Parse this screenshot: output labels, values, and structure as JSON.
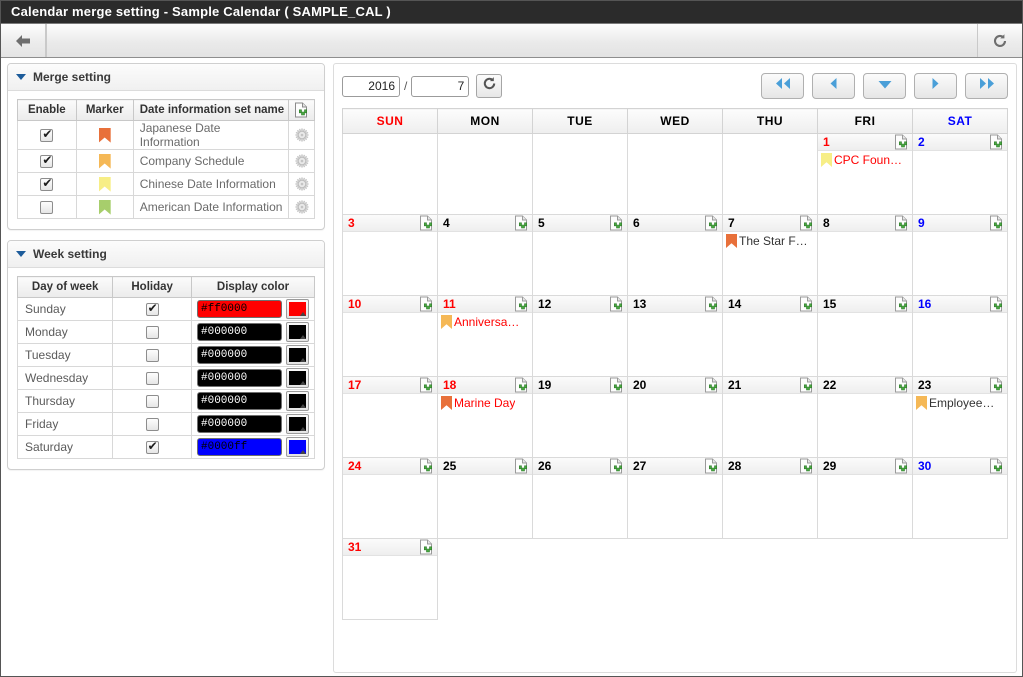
{
  "window": {
    "title": "Calendar merge setting - Sample Calendar ( SAMPLE_CAL )"
  },
  "toolbar": {
    "back_icon": "back-arrow-icon",
    "refresh_icon": "refresh-icon"
  },
  "merge_setting": {
    "panel_title": "Merge setting",
    "columns": [
      "Enable",
      "Marker",
      "Date information set name"
    ],
    "add_icon": "new-document-icon",
    "rows": [
      {
        "enabled": true,
        "marker_color": "#e8703a",
        "name": "Japanese Date Information",
        "gear_icon": "gear-icon"
      },
      {
        "enabled": true,
        "marker_color": "#f5b856",
        "name": "Company Schedule",
        "gear_icon": "gear-icon"
      },
      {
        "enabled": true,
        "marker_color": "#f7ee86",
        "name": "Chinese Date Information",
        "gear_icon": "gear-icon"
      },
      {
        "enabled": false,
        "marker_color": "#a7ce6c",
        "name": "American Date Information",
        "gear_icon": "gear-icon"
      }
    ]
  },
  "week_setting": {
    "panel_title": "Week setting",
    "columns": [
      "Day of week",
      "Holiday",
      "Display color"
    ],
    "rows": [
      {
        "day": "Sunday",
        "holiday": true,
        "color_value": "#ff0000",
        "swatch": "#ff0000",
        "text_color": "#000000"
      },
      {
        "day": "Monday",
        "holiday": false,
        "color_value": "#000000",
        "swatch": "#000000",
        "text_color": "#ffffff"
      },
      {
        "day": "Tuesday",
        "holiday": false,
        "color_value": "#000000",
        "swatch": "#000000",
        "text_color": "#ffffff"
      },
      {
        "day": "Wednesday",
        "holiday": false,
        "color_value": "#000000",
        "swatch": "#000000",
        "text_color": "#ffffff"
      },
      {
        "day": "Thursday",
        "holiday": false,
        "color_value": "#000000",
        "swatch": "#000000",
        "text_color": "#ffffff"
      },
      {
        "day": "Friday",
        "holiday": false,
        "color_value": "#000000",
        "swatch": "#000000",
        "text_color": "#ffffff"
      },
      {
        "day": "Saturday",
        "holiday": true,
        "color_value": "#0000ff",
        "swatch": "#0000ff",
        "text_color": "#000000"
      }
    ]
  },
  "calendar": {
    "year": "2016",
    "month": "7",
    "separator": "/",
    "reload_icon": "refresh-icon",
    "nav": [
      {
        "name": "first-button",
        "icon": "double-left-arrow-icon"
      },
      {
        "name": "previous-button",
        "icon": "left-arrow-icon"
      },
      {
        "name": "today-button",
        "icon": "down-arrow-icon"
      },
      {
        "name": "next-button",
        "icon": "right-arrow-icon"
      },
      {
        "name": "last-button",
        "icon": "double-right-arrow-icon"
      }
    ],
    "weekday_headers": [
      {
        "label": "SUN",
        "color": "#ff0000"
      },
      {
        "label": "MON",
        "color": "#000000"
      },
      {
        "label": "TUE",
        "color": "#000000"
      },
      {
        "label": "WED",
        "color": "#000000"
      },
      {
        "label": "THU",
        "color": "#000000"
      },
      {
        "label": "FRI",
        "color": "#000000"
      },
      {
        "label": "SAT",
        "color": "#0000ff"
      }
    ],
    "add_event_icon": "new-document-icon",
    "weeks": [
      [
        {
          "type": "blank"
        },
        {
          "type": "blank"
        },
        {
          "type": "blank"
        },
        {
          "type": "blank"
        },
        {
          "type": "blank"
        },
        {
          "type": "day",
          "num": "1",
          "color": "#ff0000",
          "events": [
            {
              "marker_color": "#f7ee86",
              "text": "CPC Foun…",
              "text_color": "#ff0000"
            }
          ]
        },
        {
          "type": "day",
          "num": "2",
          "color": "#0000ff",
          "events": []
        }
      ],
      [
        {
          "type": "day",
          "num": "3",
          "color": "#ff0000",
          "events": []
        },
        {
          "type": "day",
          "num": "4",
          "color": "#000000",
          "events": []
        },
        {
          "type": "day",
          "num": "5",
          "color": "#000000",
          "events": []
        },
        {
          "type": "day",
          "num": "6",
          "color": "#000000",
          "events": []
        },
        {
          "type": "day",
          "num": "7",
          "color": "#000000",
          "events": [
            {
              "marker_color": "#e8703a",
              "text": "The Star F…",
              "text_color": "#333333"
            }
          ]
        },
        {
          "type": "day",
          "num": "8",
          "color": "#000000",
          "events": []
        },
        {
          "type": "day",
          "num": "9",
          "color": "#0000ff",
          "events": []
        }
      ],
      [
        {
          "type": "day",
          "num": "10",
          "color": "#ff0000",
          "events": []
        },
        {
          "type": "day",
          "num": "11",
          "color": "#ff0000",
          "events": [
            {
              "marker_color": "#f5b856",
              "text": "Anniversa…",
              "text_color": "#ff0000"
            }
          ]
        },
        {
          "type": "day",
          "num": "12",
          "color": "#000000",
          "events": []
        },
        {
          "type": "day",
          "num": "13",
          "color": "#000000",
          "events": []
        },
        {
          "type": "day",
          "num": "14",
          "color": "#000000",
          "events": []
        },
        {
          "type": "day",
          "num": "15",
          "color": "#000000",
          "events": []
        },
        {
          "type": "day",
          "num": "16",
          "color": "#0000ff",
          "events": []
        }
      ],
      [
        {
          "type": "day",
          "num": "17",
          "color": "#ff0000",
          "events": []
        },
        {
          "type": "day",
          "num": "18",
          "color": "#ff0000",
          "events": [
            {
              "marker_color": "#e8703a",
              "text": "Marine Day",
              "text_color": "#ff0000"
            }
          ]
        },
        {
          "type": "day",
          "num": "19",
          "color": "#000000",
          "events": []
        },
        {
          "type": "day",
          "num": "20",
          "color": "#000000",
          "events": []
        },
        {
          "type": "day",
          "num": "21",
          "color": "#000000",
          "events": []
        },
        {
          "type": "day",
          "num": "22",
          "color": "#000000",
          "events": []
        },
        {
          "type": "day",
          "num": "23",
          "color": "#000000",
          "events": [
            {
              "marker_color": "#f5b856",
              "text": "Employee…",
              "text_color": "#333333"
            }
          ]
        }
      ],
      [
        {
          "type": "day",
          "num": "24",
          "color": "#ff0000",
          "events": []
        },
        {
          "type": "day",
          "num": "25",
          "color": "#000000",
          "events": []
        },
        {
          "type": "day",
          "num": "26",
          "color": "#000000",
          "events": []
        },
        {
          "type": "day",
          "num": "27",
          "color": "#000000",
          "events": []
        },
        {
          "type": "day",
          "num": "28",
          "color": "#000000",
          "events": []
        },
        {
          "type": "day",
          "num": "29",
          "color": "#000000",
          "events": []
        },
        {
          "type": "day",
          "num": "30",
          "color": "#0000ff",
          "events": []
        }
      ],
      [
        {
          "type": "day",
          "num": "31",
          "color": "#ff0000",
          "events": []
        },
        {
          "type": "blank"
        },
        {
          "type": "blank"
        },
        {
          "type": "blank"
        },
        {
          "type": "blank"
        },
        {
          "type": "blank"
        },
        {
          "type": "blank"
        }
      ]
    ]
  }
}
